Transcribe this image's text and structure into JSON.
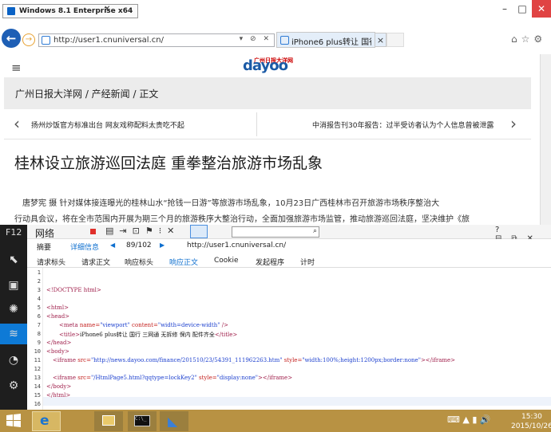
{
  "window": {
    "label": "Windows 8.1 Enterprise x64",
    "close": "✕",
    "min": "–",
    "max": "□",
    "close_btn": "✕"
  },
  "browser": {
    "address": "http://user1.cnuniversal.cn/",
    "address_tools": "▾ ⊘ ✕",
    "tab_title": "iPhone6 plus转让 国行 三...",
    "tab_close": "×",
    "toolbar_icons": "⌂☆⚙"
  },
  "page": {
    "logo_top": "广州日报大洋网",
    "logo_main": "dayoo",
    "breadcrumb": "广州日报大洋网  /  产经新闻  /  正文",
    "news_left": "扬州炒饭官方标准出台 网友戏称配料太贵吃不起",
    "news_right": "中消报告刊30年报告：过半受访者认为个人信息曾被泄露",
    "headline": "桂林设立旅游巡回法庭 重拳整治旅游市场乱象",
    "byline": "唐梦宪    摄               针对媒体接连曝光的桂林山水“抢钱一日游”等旅游市场乱象，10月23日广西桂林市召开旅游市场秩序整治大",
    "lead": "行动具会议，将在全市范围内开展为期三个月的旅游秩序大整治行动，全面加强旅游市场监管，推动旅游巡回法庭，坚决维护《旅"
  },
  "devtools": {
    "f12": "F12",
    "title": "网络",
    "summary": "摘要",
    "details": "详细信息",
    "prev": "◀",
    "count": "89/102",
    "next": "▶",
    "url": "http://user1.cnuniversal.cn/",
    "window_controls": "?⊟⧉✕",
    "subtabs": [
      "请求标头",
      "请求正文",
      "响应标头",
      "响应正文",
      "Cookie",
      "发起程序",
      "计时"
    ]
  },
  "code": {
    "line_numbers": [
      "1",
      "2",
      "3",
      "4",
      "5",
      "6",
      "7",
      "8",
      "9",
      "10",
      "11",
      "12",
      "13",
      "14",
      "15",
      "16"
    ],
    "doctype": "<!DOCTYPE html>",
    "html_open": "<html>",
    "head_open": "<head>",
    "meta_tag": "<meta",
    "meta_name_attr": " name=",
    "meta_name_val": "\"viewport\"",
    "meta_content_attr": " content=",
    "meta_content_val": "\"width=device-width\"",
    "meta_close": " />",
    "title_open": "<title>",
    "title_text": "iPhone6 plus转让 国行 三网通 无拆修 保内 配件齐全",
    "title_close": "</title>",
    "head_close": "</head>",
    "body_open": "<body>",
    "iframe1_open": "<iframe",
    "iframe1_src_attr": " src=",
    "iframe1_src_val": "\"http://news.dayoo.com/finance/201510/23/54391_111962263.htm\"",
    "iframe1_style_attr": " style=",
    "iframe1_style_val": "\"width:100%;height:1200px;border:none\"",
    "iframe1_close": "></iframe>",
    "iframe2_open": "<iframe",
    "iframe2_src_attr": " src=",
    "iframe2_src_val": "\"/HtmlPage5.html?qqtype=lockKey2\"",
    "iframe2_style_attr": " style=",
    "iframe2_style_val": "\"display:none\"",
    "iframe2_close": "></iframe>",
    "body_close": "</body>",
    "html_close": "</html>"
  },
  "taskbar": {
    "time": "15:30",
    "date": "2015/10/26",
    "tray": "⌨ ▲ ▮ 🔊"
  },
  "colors": {
    "accent": "#0e7ad6",
    "taskbar": "#b89243",
    "dev_sidebar": "#1e1e1e",
    "close_red": "#e04343"
  }
}
